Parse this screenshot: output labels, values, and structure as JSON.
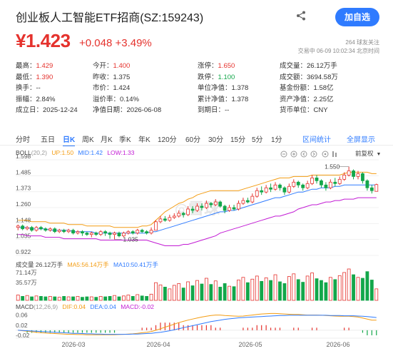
{
  "header": {
    "title": "创业板人工智能ETF招商(SZ:159243)",
    "follow_button": "加自选"
  },
  "price": {
    "last": "¥1.423",
    "change": "+0.048",
    "pct": "+3.49%"
  },
  "meta": {
    "followers": "264 球友关注",
    "timestamp": "交易中 06-09 10:02:34 北京时间"
  },
  "quote_rows": [
    [
      {
        "label": "最高：",
        "value": "1.429",
        "color": "red"
      },
      {
        "label": "今开：",
        "value": "1.400",
        "color": "red"
      },
      {
        "label": "涨停：",
        "value": "1.650",
        "color": "red"
      },
      {
        "label": "成交量：",
        "value": "26.12万手",
        "color": ""
      }
    ],
    [
      {
        "label": "最低：",
        "value": "1.390",
        "color": "red"
      },
      {
        "label": "昨收：",
        "value": "1.375",
        "color": ""
      },
      {
        "label": "跌停：",
        "value": "1.100",
        "color": "green"
      },
      {
        "label": "成交额：",
        "value": "3694.58万",
        "color": ""
      }
    ],
    [
      {
        "label": "换手：",
        "value": "--",
        "color": ""
      },
      {
        "label": "市价：",
        "value": "1.424",
        "color": ""
      },
      {
        "label": "单位净值：",
        "value": "1.378",
        "color": ""
      },
      {
        "label": "基金份额：",
        "value": "1.58亿",
        "color": ""
      }
    ],
    [
      {
        "label": "振幅：",
        "value": "2.84%",
        "color": ""
      },
      {
        "label": "溢价率：",
        "value": "0.14%",
        "color": ""
      },
      {
        "label": "累计净值：",
        "value": "1.378",
        "color": ""
      },
      {
        "label": "资产净值：",
        "value": "2.25亿",
        "color": ""
      }
    ],
    [
      {
        "label": "成立日：",
        "value": "2025-12-24",
        "color": ""
      },
      {
        "label": "净值日期：",
        "value": "2026-06-08",
        "color": ""
      },
      {
        "label": "到期日：",
        "value": "--",
        "color": ""
      },
      {
        "label": "货币单位：",
        "value": "CNY",
        "color": ""
      }
    ]
  ],
  "periods": [
    "分时",
    "五日",
    "日K",
    "周K",
    "月K",
    "季K",
    "年K",
    "120分",
    "60分",
    "30分",
    "15分",
    "5分",
    "1分"
  ],
  "active_period": "日K",
  "chart_links": {
    "range_stats": "区间统计",
    "fullscreen": "全屏显示"
  },
  "adjust": "前复权",
  "boll": {
    "name": "BOLL",
    "params": "(20,2)",
    "up": "UP:1.50",
    "mid": "MID:1.42",
    "low": "LOW:1.33"
  },
  "price_axis": [
    "1.598",
    "1.485",
    "1.373",
    "1.260",
    "1.148",
    "1.035",
    "0.922"
  ],
  "annotations": {
    "high": "1.550",
    "low": "1.035"
  },
  "volume": {
    "label": "成交量 26.12万手",
    "ma5": "MA5:56.14万手",
    "ma10": "MA10:50.41万手",
    "axis": [
      "71.14万",
      "35.57万"
    ]
  },
  "macd": {
    "label": "MACD",
    "params": "(12,26,9)",
    "dif": "DIF:0.04",
    "dea": "DEA:0.04",
    "macd": "MACD:-0.02",
    "axis": [
      "0.06",
      "0.02",
      "-0.02"
    ]
  },
  "xaxis": [
    "2026-03",
    "2026-04",
    "2026-05",
    "2026-06"
  ],
  "colors": {
    "up": "#e5322d",
    "down": "#13a74a",
    "boll_up": "#f39c12",
    "boll_mid": "#2f7bff",
    "boll_low": "#c21bd4",
    "accent": "#2f7bff"
  },
  "chart_data": {
    "type": "candlestick",
    "ylim": [
      0.922,
      1.598
    ],
    "candles": [
      [
        1.12,
        1.13,
        1.14,
        1.1
      ],
      [
        1.13,
        1.11,
        1.14,
        1.1
      ],
      [
        1.11,
        1.12,
        1.13,
        1.1
      ],
      [
        1.12,
        1.1,
        1.13,
        1.09
      ],
      [
        1.1,
        1.12,
        1.13,
        1.09
      ],
      [
        1.12,
        1.11,
        1.13,
        1.1
      ],
      [
        1.11,
        1.1,
        1.12,
        1.09
      ],
      [
        1.1,
        1.11,
        1.12,
        1.09
      ],
      [
        1.11,
        1.09,
        1.12,
        1.08
      ],
      [
        1.09,
        1.1,
        1.11,
        1.08
      ],
      [
        1.1,
        1.09,
        1.11,
        1.08
      ],
      [
        1.09,
        1.1,
        1.11,
        1.08
      ],
      [
        1.1,
        1.08,
        1.11,
        1.07
      ],
      [
        1.08,
        1.09,
        1.1,
        1.07
      ],
      [
        1.09,
        1.08,
        1.1,
        1.06
      ],
      [
        1.08,
        1.07,
        1.09,
        1.06
      ],
      [
        1.07,
        1.08,
        1.09,
        1.05
      ],
      [
        1.08,
        1.07,
        1.09,
        1.06
      ],
      [
        1.07,
        1.09,
        1.1,
        1.06
      ],
      [
        1.09,
        1.08,
        1.1,
        1.06
      ],
      [
        1.08,
        1.07,
        1.09,
        1.04
      ],
      [
        1.07,
        1.08,
        1.09,
        1.035
      ],
      [
        1.08,
        1.06,
        1.09,
        1.05
      ],
      [
        1.06,
        1.08,
        1.09,
        1.05
      ],
      [
        1.08,
        1.09,
        1.1,
        1.07
      ],
      [
        1.09,
        1.08,
        1.1,
        1.07
      ],
      [
        1.08,
        1.1,
        1.11,
        1.07
      ],
      [
        1.1,
        1.09,
        1.11,
        1.08
      ],
      [
        1.09,
        1.08,
        1.1,
        1.07
      ],
      [
        1.08,
        1.1,
        1.12,
        1.07
      ],
      [
        1.1,
        1.16,
        1.17,
        1.1
      ],
      [
        1.16,
        1.18,
        1.2,
        1.15
      ],
      [
        1.18,
        1.17,
        1.2,
        1.16
      ],
      [
        1.17,
        1.19,
        1.21,
        1.16
      ],
      [
        1.19,
        1.2,
        1.22,
        1.18
      ],
      [
        1.2,
        1.22,
        1.24,
        1.19
      ],
      [
        1.22,
        1.21,
        1.23,
        1.19
      ],
      [
        1.21,
        1.25,
        1.27,
        1.2
      ],
      [
        1.25,
        1.24,
        1.27,
        1.22
      ],
      [
        1.24,
        1.27,
        1.29,
        1.23
      ],
      [
        1.27,
        1.26,
        1.29,
        1.24
      ],
      [
        1.26,
        1.29,
        1.31,
        1.25
      ],
      [
        1.29,
        1.28,
        1.3,
        1.26
      ],
      [
        1.28,
        1.3,
        1.32,
        1.27
      ],
      [
        1.3,
        1.27,
        1.31,
        1.26
      ],
      [
        1.27,
        1.24,
        1.28,
        1.22
      ],
      [
        1.24,
        1.26,
        1.28,
        1.23
      ],
      [
        1.26,
        1.25,
        1.28,
        1.24
      ],
      [
        1.25,
        1.29,
        1.31,
        1.24
      ],
      [
        1.29,
        1.31,
        1.33,
        1.28
      ],
      [
        1.31,
        1.3,
        1.33,
        1.29
      ],
      [
        1.3,
        1.34,
        1.36,
        1.29
      ],
      [
        1.34,
        1.38,
        1.4,
        1.33
      ],
      [
        1.38,
        1.37,
        1.41,
        1.35
      ],
      [
        1.37,
        1.4,
        1.42,
        1.36
      ],
      [
        1.4,
        1.39,
        1.43,
        1.37
      ],
      [
        1.39,
        1.42,
        1.44,
        1.38
      ],
      [
        1.42,
        1.4,
        1.43,
        1.38
      ],
      [
        1.4,
        1.37,
        1.41,
        1.35
      ],
      [
        1.37,
        1.41,
        1.43,
        1.36
      ],
      [
        1.41,
        1.44,
        1.46,
        1.4
      ],
      [
        1.44,
        1.42,
        1.45,
        1.4
      ],
      [
        1.42,
        1.4,
        1.43,
        1.38
      ],
      [
        1.4,
        1.43,
        1.45,
        1.39
      ],
      [
        1.43,
        1.47,
        1.49,
        1.42
      ],
      [
        1.47,
        1.45,
        1.49,
        1.43
      ],
      [
        1.45,
        1.42,
        1.46,
        1.4
      ],
      [
        1.42,
        1.4,
        1.44,
        1.38
      ],
      [
        1.4,
        1.44,
        1.46,
        1.39
      ],
      [
        1.44,
        1.43,
        1.47,
        1.41
      ],
      [
        1.43,
        1.46,
        1.48,
        1.42
      ],
      [
        1.46,
        1.49,
        1.51,
        1.45
      ],
      [
        1.49,
        1.52,
        1.55,
        1.48
      ],
      [
        1.52,
        1.48,
        1.53,
        1.46
      ],
      [
        1.48,
        1.5,
        1.52,
        1.46
      ],
      [
        1.5,
        1.45,
        1.51,
        1.43
      ],
      [
        1.45,
        1.4,
        1.46,
        1.38
      ],
      [
        1.4,
        1.38,
        1.42,
        1.36
      ],
      [
        1.375,
        1.423,
        1.429,
        1.39
      ]
    ],
    "boll_up": [
      1.17,
      1.17,
      1.17,
      1.16,
      1.16,
      1.16,
      1.16,
      1.15,
      1.15,
      1.15,
      1.15,
      1.14,
      1.14,
      1.14,
      1.14,
      1.13,
      1.13,
      1.13,
      1.13,
      1.13,
      1.13,
      1.12,
      1.12,
      1.12,
      1.12,
      1.12,
      1.12,
      1.13,
      1.13,
      1.14,
      1.17,
      1.2,
      1.23,
      1.25,
      1.27,
      1.29,
      1.3,
      1.32,
      1.33,
      1.35,
      1.36,
      1.37,
      1.38,
      1.38,
      1.38,
      1.38,
      1.38,
      1.38,
      1.38,
      1.39,
      1.4,
      1.41,
      1.42,
      1.43,
      1.44,
      1.45,
      1.46,
      1.47,
      1.47,
      1.47,
      1.48,
      1.48,
      1.48,
      1.48,
      1.49,
      1.49,
      1.49,
      1.49,
      1.49,
      1.49,
      1.49,
      1.5,
      1.51,
      1.51,
      1.51,
      1.51,
      1.51,
      1.5,
      1.5
    ],
    "boll_mid": [
      1.12,
      1.12,
      1.12,
      1.11,
      1.11,
      1.11,
      1.11,
      1.1,
      1.1,
      1.1,
      1.1,
      1.1,
      1.09,
      1.09,
      1.09,
      1.09,
      1.09,
      1.08,
      1.08,
      1.08,
      1.08,
      1.08,
      1.08,
      1.08,
      1.08,
      1.08,
      1.08,
      1.08,
      1.08,
      1.09,
      1.09,
      1.1,
      1.11,
      1.12,
      1.13,
      1.14,
      1.15,
      1.16,
      1.17,
      1.18,
      1.19,
      1.2,
      1.21,
      1.22,
      1.23,
      1.23,
      1.24,
      1.24,
      1.25,
      1.26,
      1.27,
      1.28,
      1.29,
      1.3,
      1.31,
      1.32,
      1.33,
      1.33,
      1.34,
      1.35,
      1.36,
      1.37,
      1.37,
      1.38,
      1.39,
      1.39,
      1.4,
      1.4,
      1.4,
      1.41,
      1.41,
      1.42,
      1.42,
      1.42,
      1.42,
      1.42,
      1.42,
      1.42,
      1.42
    ],
    "boll_low": [
      1.07,
      1.07,
      1.06,
      1.06,
      1.06,
      1.06,
      1.05,
      1.05,
      1.05,
      1.05,
      1.04,
      1.04,
      1.04,
      1.04,
      1.04,
      1.04,
      1.04,
      1.04,
      1.03,
      1.03,
      1.03,
      1.03,
      1.03,
      1.03,
      1.03,
      1.03,
      1.03,
      1.03,
      1.03,
      1.02,
      1.01,
      1.0,
      0.99,
      0.99,
      0.99,
      0.99,
      1.0,
      1.0,
      1.01,
      1.02,
      1.03,
      1.04,
      1.05,
      1.06,
      1.08,
      1.09,
      1.1,
      1.11,
      1.12,
      1.13,
      1.14,
      1.15,
      1.16,
      1.17,
      1.18,
      1.19,
      1.2,
      1.2,
      1.21,
      1.22,
      1.23,
      1.25,
      1.26,
      1.27,
      1.28,
      1.28,
      1.29,
      1.3,
      1.3,
      1.31,
      1.31,
      1.32,
      1.32,
      1.32,
      1.33,
      1.33,
      1.33,
      1.33,
      1.33
    ],
    "volumes": [
      12,
      9,
      11,
      8,
      10,
      9,
      8,
      9,
      8,
      7,
      9,
      8,
      8,
      9,
      7,
      8,
      8,
      7,
      9,
      8,
      9,
      11,
      8,
      10,
      12,
      9,
      13,
      10,
      9,
      14,
      40,
      35,
      30,
      26,
      34,
      38,
      28,
      42,
      33,
      45,
      37,
      50,
      36,
      44,
      30,
      38,
      32,
      31,
      46,
      52,
      40,
      48,
      55,
      43,
      51,
      45,
      58,
      42,
      38,
      54,
      60,
      47,
      41,
      55,
      62,
      49,
      45,
      40,
      52,
      47,
      56,
      63,
      71,
      58,
      52,
      50,
      65,
      46,
      26
    ],
    "macd": [
      0.0,
      0.0,
      -0.01,
      -0.01,
      -0.01,
      -0.01,
      -0.01,
      -0.01,
      -0.01,
      -0.01,
      -0.01,
      -0.01,
      -0.01,
      -0.01,
      -0.01,
      -0.01,
      -0.01,
      -0.01,
      -0.01,
      -0.01,
      -0.01,
      -0.01,
      0.0,
      0.0,
      0.0,
      0.0,
      0.0,
      0.01,
      0.01,
      0.01,
      0.02,
      0.03,
      0.03,
      0.03,
      0.03,
      0.03,
      0.02,
      0.02,
      0.02,
      0.02,
      0.02,
      0.02,
      0.02,
      0.01,
      0.01,
      0.0,
      0.0,
      0.0,
      0.0,
      0.01,
      0.01,
      0.01,
      0.02,
      0.02,
      0.02,
      0.01,
      0.01,
      0.01,
      0.0,
      0.0,
      0.01,
      0.01,
      0.0,
      0.0,
      0.01,
      0.01,
      0.0,
      0.0,
      0.0,
      0.0,
      0.0,
      0.01,
      0.01,
      0.0,
      0.0,
      -0.01,
      -0.02,
      -0.02,
      -0.02
    ],
    "dif": [
      0.0,
      -0.002,
      -0.004,
      -0.006,
      -0.008,
      -0.01,
      -0.011,
      -0.012,
      -0.013,
      -0.014,
      -0.015,
      -0.016,
      -0.016,
      -0.017,
      -0.017,
      -0.018,
      -0.018,
      -0.018,
      -0.018,
      -0.018,
      -0.018,
      -0.018,
      -0.017,
      -0.016,
      -0.015,
      -0.014,
      -0.012,
      -0.01,
      -0.008,
      -0.005,
      0.0,
      0.006,
      0.012,
      0.018,
      0.024,
      0.03,
      0.035,
      0.04,
      0.044,
      0.048,
      0.052,
      0.055,
      0.058,
      0.06,
      0.06,
      0.058,
      0.057,
      0.056,
      0.055,
      0.056,
      0.058,
      0.06,
      0.062,
      0.064,
      0.065,
      0.066,
      0.066,
      0.065,
      0.064,
      0.063,
      0.062,
      0.062,
      0.061,
      0.06,
      0.06,
      0.06,
      0.059,
      0.058,
      0.057,
      0.056,
      0.055,
      0.055,
      0.055,
      0.054,
      0.052,
      0.048,
      0.044,
      0.04,
      0.04
    ],
    "dea": [
      0.0,
      -0.001,
      -0.002,
      -0.003,
      -0.004,
      -0.005,
      -0.006,
      -0.007,
      -0.008,
      -0.009,
      -0.01,
      -0.011,
      -0.012,
      -0.012,
      -0.013,
      -0.014,
      -0.014,
      -0.015,
      -0.015,
      -0.016,
      -0.016,
      -0.016,
      -0.016,
      -0.016,
      -0.016,
      -0.015,
      -0.015,
      -0.014,
      -0.013,
      -0.012,
      -0.01,
      -0.008,
      -0.005,
      -0.002,
      0.002,
      0.006,
      0.01,
      0.014,
      0.018,
      0.022,
      0.026,
      0.03,
      0.034,
      0.037,
      0.04,
      0.043,
      0.045,
      0.047,
      0.049,
      0.05,
      0.051,
      0.052,
      0.053,
      0.054,
      0.055,
      0.056,
      0.057,
      0.058,
      0.058,
      0.059,
      0.059,
      0.059,
      0.059,
      0.059,
      0.059,
      0.059,
      0.059,
      0.059,
      0.058,
      0.058,
      0.058,
      0.057,
      0.057,
      0.057,
      0.056,
      0.055,
      0.054,
      0.052,
      0.05
    ]
  }
}
